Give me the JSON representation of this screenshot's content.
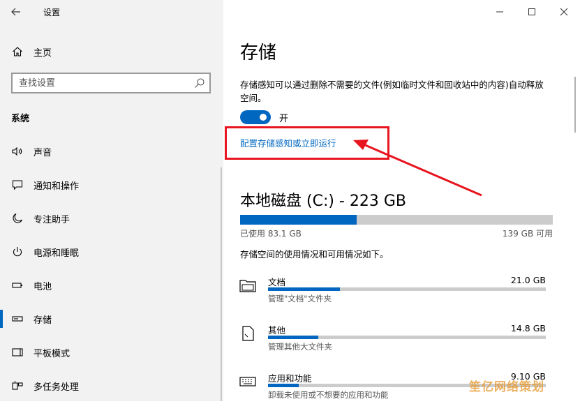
{
  "window": {
    "title": "设置"
  },
  "sidebar": {
    "home_label": "主页",
    "search_placeholder": "查找设置",
    "section_label": "系统",
    "items": [
      {
        "label": "声音",
        "icon": "speaker-icon"
      },
      {
        "label": "通知和操作",
        "icon": "notification-icon"
      },
      {
        "label": "专注助手",
        "icon": "moon-icon"
      },
      {
        "label": "电源和睡眠",
        "icon": "power-icon"
      },
      {
        "label": "电池",
        "icon": "battery-icon"
      },
      {
        "label": "存储",
        "icon": "storage-icon",
        "selected": true
      },
      {
        "label": "平板模式",
        "icon": "tablet-icon"
      },
      {
        "label": "多任务处理",
        "icon": "multitask-icon"
      }
    ]
  },
  "main": {
    "title": "存储",
    "description": "存储感知可以通过删除不需要的文件(例如临时文件和回收站中的内容)自动释放空间。",
    "toggle": {
      "state_label": "开",
      "on": true
    },
    "config_link": "配置存储感知或立即运行",
    "disk": {
      "title": "本地磁盘 (C:) - 223 GB",
      "used_label": "已使用 83.1 GB",
      "free_label": "139 GB 可用",
      "used_fraction": 0.373
    },
    "usage_description": "存储空间的使用情况和可用情况如下。",
    "categories": [
      {
        "name": "文档",
        "size": "21.0 GB",
        "sub": "管理\"文档\"文件夹",
        "fraction": 0.26,
        "icon": "folder-icon"
      },
      {
        "name": "其他",
        "size": "14.8 GB",
        "sub": "管理其他大文件夹",
        "fraction": 0.18,
        "icon": "file-icon"
      },
      {
        "name": "应用和功能",
        "size": "9.10 GB",
        "sub": "卸载未使用或不想要的应用和功能",
        "fraction": 0.11,
        "icon": "keyboard-icon"
      }
    ]
  },
  "watermark": "笙亿网络策划",
  "colors": {
    "accent": "#0067c0",
    "annotation": "#e8141e"
  }
}
